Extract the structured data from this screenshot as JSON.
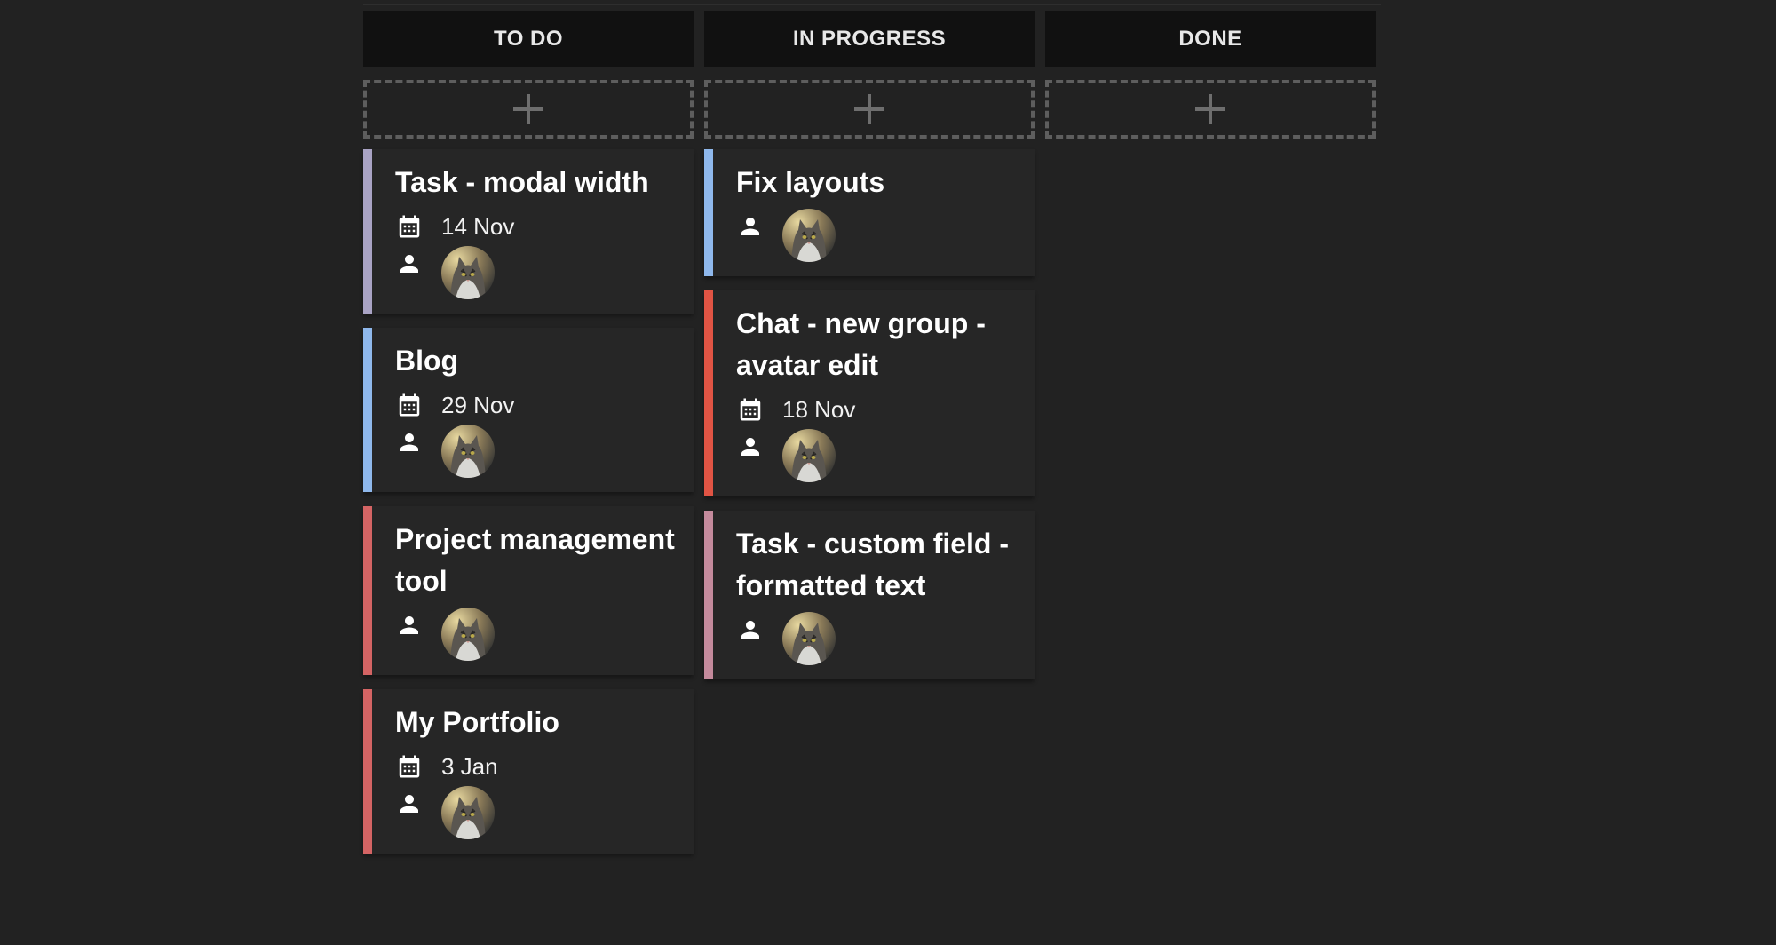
{
  "columns": [
    {
      "title": "TO DO",
      "add_icon": "plus-icon",
      "cards": [
        {
          "title": "Task - modal width",
          "date": "14 Nov",
          "accent": "#a9a3c4"
        },
        {
          "title": "Blog",
          "date": "29 Nov",
          "accent": "#8fb8ec"
        },
        {
          "title": "Project management tool",
          "date": null,
          "accent": "#d46464"
        },
        {
          "title": "My Portfolio",
          "date": "3 Jan",
          "accent": "#d46464"
        }
      ]
    },
    {
      "title": "IN PROGRESS",
      "add_icon": "plus-icon",
      "cards": [
        {
          "title": "Fix layouts",
          "date": null,
          "accent": "#8fb8ec"
        },
        {
          "title": "Chat - new group - avatar edit",
          "date": "18 Nov",
          "accent": "#e05444"
        },
        {
          "title": "Task - custom field - formatted text",
          "date": null,
          "accent": "#c48a9c"
        }
      ]
    },
    {
      "title": "DONE",
      "add_icon": "plus-icon",
      "cards": []
    }
  ],
  "icons": {
    "date": "calendar-icon",
    "assignee": "person-icon",
    "avatar": "cat-avatar"
  },
  "colors": {
    "background": "#222222",
    "header": "#111111",
    "card": "#262626"
  }
}
